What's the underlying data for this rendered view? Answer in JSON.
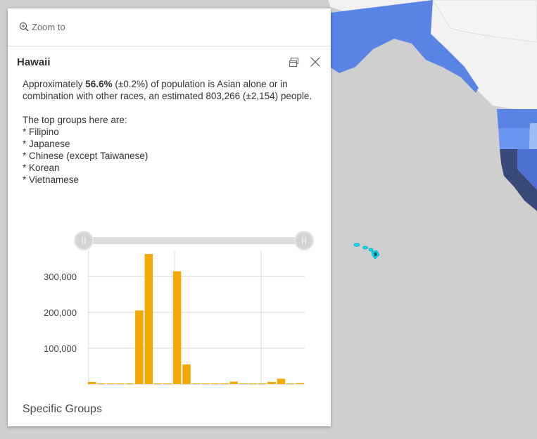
{
  "popup": {
    "zoom_label": "Zoom to",
    "title": "Hawaii",
    "intro": {
      "prefix": "Approximately ",
      "percent": "56.6%",
      "suffix": " (±0.2%) of population is Asian alone or in combination with other races, an estimated 803,266 (±2,154) people."
    },
    "top_groups_heading": "The top groups here are:",
    "top_groups": [
      "* Filipino",
      "* Japanese",
      "* Chinese (except Taiwanese)",
      "* Korean",
      "* Vietnamese"
    ],
    "chart_caption": "Specific Groups"
  },
  "colors": {
    "bar": "#f5a800",
    "map_water": "#cfcfcf",
    "map_land": "#f2f2f2",
    "choropleth_light": "#5a83e6",
    "choropleth_dark": "#3a4a78",
    "hawaii_highlight": "#00e5ff"
  },
  "chart_data": {
    "type": "bar",
    "title": "",
    "xlabel": "",
    "ylabel": "",
    "ylim": [
      0,
      370000
    ],
    "yticks": [
      100000,
      200000,
      300000
    ],
    "ytick_labels": [
      "100,000",
      "200,000",
      "300,000"
    ],
    "grid": true,
    "values": [
      6000,
      0,
      0,
      0,
      0,
      205000,
      362000,
      0,
      0,
      314000,
      55000,
      2000,
      0,
      0,
      0,
      7000,
      0,
      0,
      2000,
      6000,
      15000,
      0,
      3000
    ]
  }
}
